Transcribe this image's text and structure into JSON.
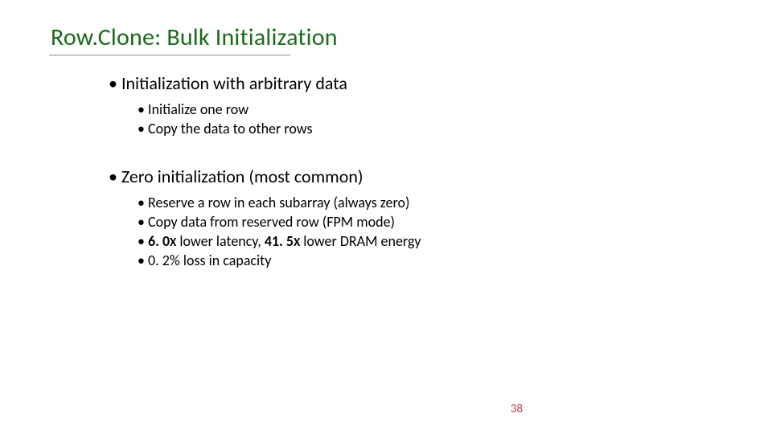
{
  "title": "Row.Clone: Bulk Initialization",
  "sections": [
    {
      "heading": "Initialization with arbitrary data",
      "items": [
        "Initialize one row",
        "Copy the data to other rows"
      ]
    },
    {
      "heading": "Zero initialization (most common)",
      "items": [
        "Reserve a row in each subarray (always zero)",
        "Copy data from reserved row (FPM mode)",
        {
          "segments": [
            {
              "text": "6. 0",
              "bold": true
            },
            {
              "text": "X",
              "boldsmall": true
            },
            {
              "text": " lower latency, "
            },
            {
              "text": "41. 5",
              "bold": true
            },
            {
              "text": "X",
              "boldsmall": true
            },
            {
              "text": " lower DRAM energy"
            }
          ]
        },
        "0. 2% loss in capacity"
      ]
    }
  ],
  "page_number": "38"
}
